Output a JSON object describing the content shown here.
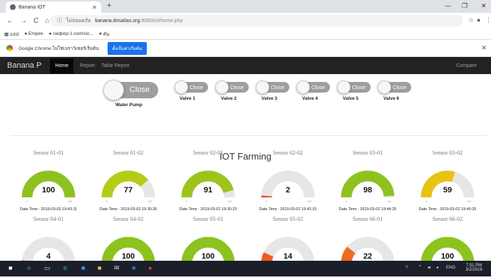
{
  "browser": {
    "tab_title": "Banana IOT",
    "address_security": "ไม่ปลอดภัย",
    "address_host": "banana.dnsalias.org",
    "address_path": ":8080/iot/home.php",
    "bookmarks": [
      "แอป",
      "Empire",
      "nadpop-1.com/cic...",
      "คัน"
    ],
    "info_message": "Google Chrome ไม่ใช่เบราว์เซอร์เริ่มต้น",
    "info_button": "ตั้งเป็นค่าเริ่มต้น"
  },
  "navbar": {
    "brand": "Banana P",
    "items": [
      "Home",
      "Report",
      "Table Report"
    ],
    "right_item": "Compare"
  },
  "pump": {
    "state": "Close",
    "label": "Water Pump"
  },
  "valves": [
    {
      "state": "Close",
      "label": "Valve 1"
    },
    {
      "state": "Close",
      "label": "Valve 2"
    },
    {
      "state": "Close",
      "label": "Valve 3"
    },
    {
      "state": "Close",
      "label": "Valve 4"
    },
    {
      "state": "Close",
      "label": "Valve 5"
    },
    {
      "state": "Close",
      "label": "Valve 6"
    }
  ],
  "main_title": "IOT Farming",
  "gauge_min": "0",
  "gauge_max": "100",
  "sensors": [
    {
      "name": "Sensor 01-01",
      "value": "100",
      "level": 100,
      "color": "#8ec21f",
      "time": "Date Time : 2019-03-02 19:43:11"
    },
    {
      "name": "Sensor 01-02",
      "value": "77",
      "level": 77,
      "color": "#b5cc16",
      "time": "Date Time : 2019-03-02 19:30:26"
    },
    {
      "name": "Sensor 02-01",
      "value": "91",
      "level": 91,
      "color": "#9dc41b",
      "time": "Date Time : 2019-03-02 19:30:23"
    },
    {
      "name": "Sensor 02-02",
      "value": "2",
      "level": 2,
      "color": "#e83e1c",
      "time": "Date Time : 2019-03-02 19:42:15"
    },
    {
      "name": "Sensor 03-01",
      "value": "98",
      "level": 98,
      "color": "#8ec21f",
      "time": "Date Time : 2019-03-02 19:44:25"
    },
    {
      "name": "Sensor 03-02",
      "value": "59",
      "level": 59,
      "color": "#e7c314",
      "time": "Date Time : 2019-03-02 19:40:25"
    },
    {
      "name": "Sensor 04-01",
      "value": "4",
      "level": 4,
      "color": "#e83e1c",
      "time": ""
    },
    {
      "name": "Sensor 04-02",
      "value": "100",
      "level": 100,
      "color": "#8ec21f",
      "time": ""
    },
    {
      "name": "Sensor 05-01",
      "value": "100",
      "level": 100,
      "color": "#8ec21f",
      "time": ""
    },
    {
      "name": "Sensor 05-02",
      "value": "14",
      "level": 14,
      "color": "#f05a1e",
      "time": ""
    },
    {
      "name": "Sensor 06-01",
      "value": "22",
      "level": 22,
      "color": "#f06a1e",
      "time": ""
    },
    {
      "name": "Sensor 06-02",
      "value": "100",
      "level": 100,
      "color": "#8ec21f",
      "time": ""
    }
  ],
  "taskbar": {
    "lang": "ENG",
    "time": "7:51 PM",
    "date": "3/2/2019"
  }
}
